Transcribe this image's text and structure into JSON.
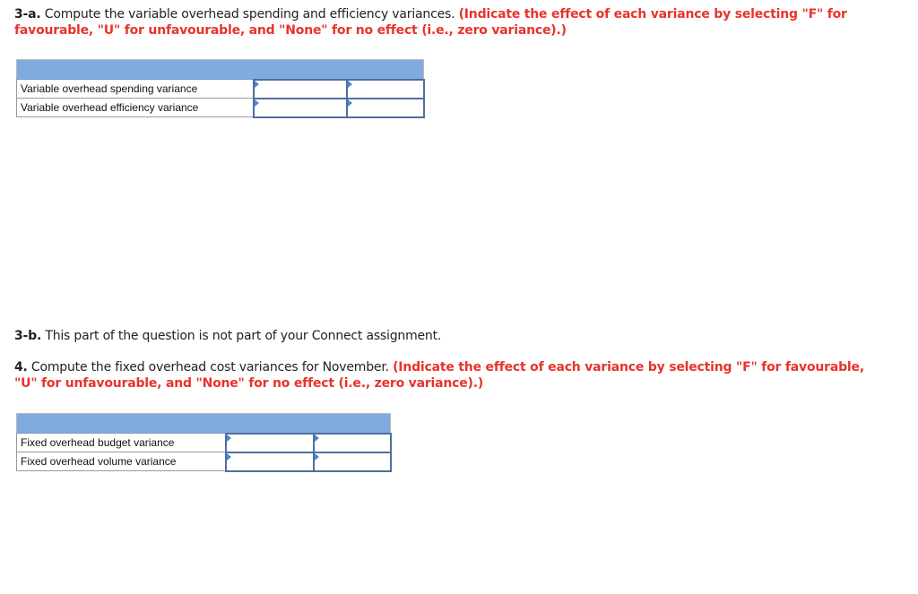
{
  "q3a": {
    "number": "3-a.",
    "text": " Compute the variable overhead spending and efficiency variances. ",
    "instruction": "(Indicate the effect of each variance by selecting \"F\" for favourable, \"U\" for unfavourable, and \"None\" for no effect (i.e., zero variance).)",
    "table": {
      "rows": [
        {
          "label": "Variable overhead spending variance",
          "amount": "",
          "effect": ""
        },
        {
          "label": "Variable overhead efficiency variance",
          "amount": "",
          "effect": ""
        }
      ]
    }
  },
  "q3b": {
    "number": "3-b.",
    "text": " This part of the question is not part of your Connect assignment."
  },
  "q4": {
    "number": "4.",
    "text": " Compute the fixed overhead cost variances for November. ",
    "instruction": "(Indicate the effect of each variance by selecting \"F\" for favourable, \"U\" for unfavourable, and \"None\" for no effect (i.e., zero variance).)",
    "table": {
      "rows": [
        {
          "label": "Fixed overhead budget variance",
          "amount": "",
          "effect": ""
        },
        {
          "label": "Fixed overhead volume variance",
          "amount": "",
          "effect": ""
        }
      ]
    }
  },
  "colors": {
    "instruction_red": "#e8332a",
    "header_blue": "#80abe0",
    "input_border": "#4e6f9c"
  }
}
